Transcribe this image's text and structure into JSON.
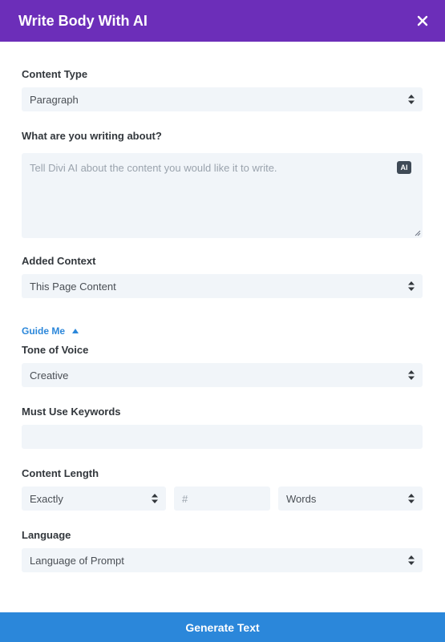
{
  "header": {
    "title": "Write Body With AI"
  },
  "form": {
    "content_type": {
      "label": "Content Type",
      "value": "Paragraph"
    },
    "topic": {
      "label": "What are you writing about?",
      "placeholder": "Tell Divi AI about the content you would like it to write.",
      "ai_badge": "AI"
    },
    "added_context": {
      "label": "Added Context",
      "value": "This Page Content"
    },
    "guide_me": {
      "label": "Guide Me"
    },
    "tone": {
      "label": "Tone of Voice",
      "value": "Creative"
    },
    "keywords": {
      "label": "Must Use Keywords",
      "value": ""
    },
    "content_length": {
      "label": "Content Length",
      "mode": "Exactly",
      "number_placeholder": "#",
      "unit": "Words"
    },
    "language": {
      "label": "Language",
      "value": "Language of Prompt"
    }
  },
  "footer": {
    "generate_label": "Generate Text"
  },
  "colors": {
    "header_bg": "#6c2eb9",
    "accent": "#2b87da",
    "field_bg": "#f1f5f9"
  }
}
